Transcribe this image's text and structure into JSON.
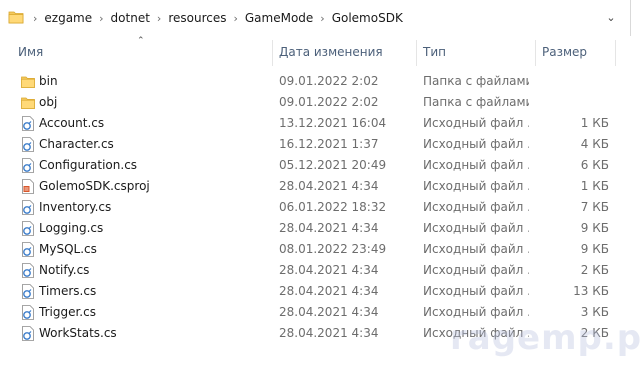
{
  "breadcrumbs": [
    "ezgame",
    "dotnet",
    "resources",
    "GameMode",
    "GolemoSDK"
  ],
  "columns": {
    "name": "Имя",
    "date": "Дата изменения",
    "type": "Тип",
    "size": "Размер"
  },
  "files": [
    {
      "name": "bin",
      "date": "09.01.2022 2:02",
      "type": "Папка с файлами",
      "size": "",
      "icon": "folder-icon"
    },
    {
      "name": "obj",
      "date": "09.01.2022 2:02",
      "type": "Папка с файлами",
      "size": "",
      "icon": "folder-icon"
    },
    {
      "name": "Account.cs",
      "date": "13.12.2021 16:04",
      "type": "Исходный файл ...",
      "size": "1 КБ",
      "icon": "cs-file-icon"
    },
    {
      "name": "Character.cs",
      "date": "16.12.2021 1:37",
      "type": "Исходный файл ...",
      "size": "4 КБ",
      "icon": "cs-file-icon"
    },
    {
      "name": "Configuration.cs",
      "date": "05.12.2021 20:49",
      "type": "Исходный файл ...",
      "size": "6 КБ",
      "icon": "cs-file-icon"
    },
    {
      "name": "GolemoSDK.csproj",
      "date": "28.04.2021 4:34",
      "type": "Исходный файл ...",
      "size": "1 КБ",
      "icon": "csproj-file-icon"
    },
    {
      "name": "Inventory.cs",
      "date": "06.01.2022 18:32",
      "type": "Исходный файл ...",
      "size": "7 КБ",
      "icon": "cs-file-icon"
    },
    {
      "name": "Logging.cs",
      "date": "28.04.2021 4:34",
      "type": "Исходный файл ...",
      "size": "9 КБ",
      "icon": "cs-file-icon"
    },
    {
      "name": "MySQL.cs",
      "date": "08.01.2022 23:49",
      "type": "Исходный файл ...",
      "size": "9 КБ",
      "icon": "cs-file-icon"
    },
    {
      "name": "Notify.cs",
      "date": "28.04.2021 4:34",
      "type": "Исходный файл ...",
      "size": "2 КБ",
      "icon": "cs-file-icon"
    },
    {
      "name": "Timers.cs",
      "date": "28.04.2021 4:34",
      "type": "Исходный файл ...",
      "size": "13 КБ",
      "icon": "cs-file-icon"
    },
    {
      "name": "Trigger.cs",
      "date": "28.04.2021 4:34",
      "type": "Исходный файл ...",
      "size": "3 КБ",
      "icon": "cs-file-icon"
    },
    {
      "name": "WorkStats.cs",
      "date": "28.04.2021 4:34",
      "type": "Исходный файл ...",
      "size": "2 КБ",
      "icon": "cs-file-icon"
    }
  ],
  "watermark": "ragemp.pro",
  "colors": {
    "header_text": "#4c607a",
    "folder": "#f4c95d",
    "cs_icon": "#3d7ecb",
    "csproj_icon": "#d9572b"
  }
}
